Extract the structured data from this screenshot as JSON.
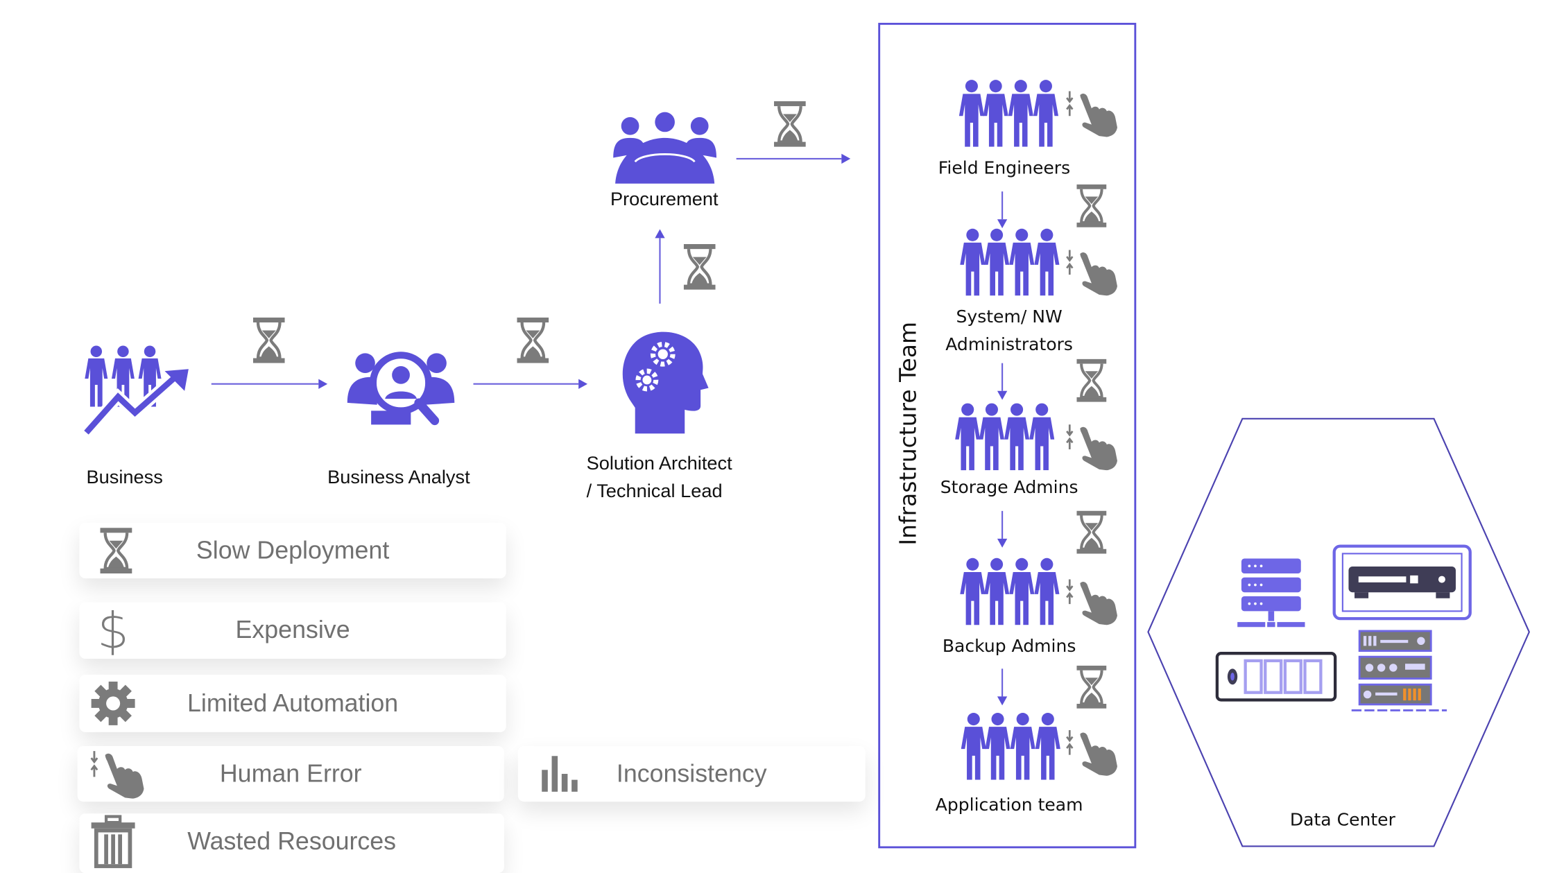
{
  "colors": {
    "accent": "#5a50d8",
    "icon_gray": "#7b7b7b",
    "text_gray": "#707070"
  },
  "flow": {
    "business": {
      "label": "Business",
      "icon": "people-growth-icon"
    },
    "analyst": {
      "label": "Business Analyst",
      "icon": "people-magnifier-icon"
    },
    "architect": {
      "label_line1": "Solution Architect",
      "label_line2": "/ Technical Lead",
      "icon": "head-gears-icon"
    },
    "procurement": {
      "label": "Procurement",
      "icon": "team-meeting-icon"
    }
  },
  "infrastructure": {
    "title": "Infrastructure Team",
    "teams": [
      {
        "label": "Field Engineers"
      },
      {
        "label_line1": "System/ NW",
        "label_line2": "Administrators"
      },
      {
        "label": "Storage Admins"
      },
      {
        "label": "Backup Admins"
      },
      {
        "label": "Application team"
      }
    ]
  },
  "datacenter": {
    "label": "Data Center"
  },
  "problems": [
    {
      "label": "Slow Deployment",
      "icon": "hourglass-icon"
    },
    {
      "label": "Expensive",
      "icon": "dollar-icon"
    },
    {
      "label": "Limited Automation",
      "icon": "gear-icon"
    },
    {
      "label": "Human Error",
      "icon": "hand-tap-icon"
    },
    {
      "label": "Wasted Resources",
      "icon": "trash-icon"
    },
    {
      "label": "Inconsistency",
      "icon": "bar-chart-icon"
    }
  ]
}
